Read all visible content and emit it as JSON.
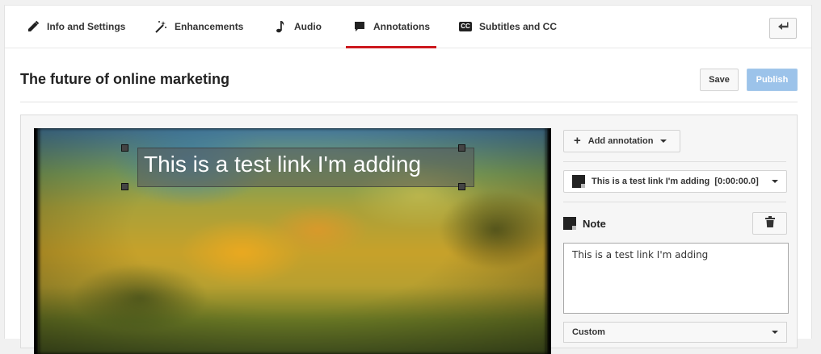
{
  "tabs": [
    {
      "label": "Info and Settings",
      "icon": "pencil-icon"
    },
    {
      "label": "Enhancements",
      "icon": "magic-wand-icon"
    },
    {
      "label": "Audio",
      "icon": "music-note-icon"
    },
    {
      "label": "Annotations",
      "icon": "speech-bubble-icon",
      "active": true
    },
    {
      "label": "Subtitles and CC",
      "icon": "cc-icon"
    }
  ],
  "header": {
    "title": "The future of online marketing",
    "save_label": "Save",
    "publish_label": "Publish",
    "cc_badge": "CC"
  },
  "video": {
    "annotation_text": "This is a test link I'm adding"
  },
  "sidebar": {
    "add_annotation_label": "Add annotation",
    "selected_annotation": "This is a test link I'm adding  [0:00:00.0]",
    "type_label": "Note",
    "note_text": "This is a test link I'm adding",
    "style_select": "Custom"
  },
  "colors": {
    "accent_red": "#cc181e",
    "publish_blue": "#9cc3ea"
  }
}
